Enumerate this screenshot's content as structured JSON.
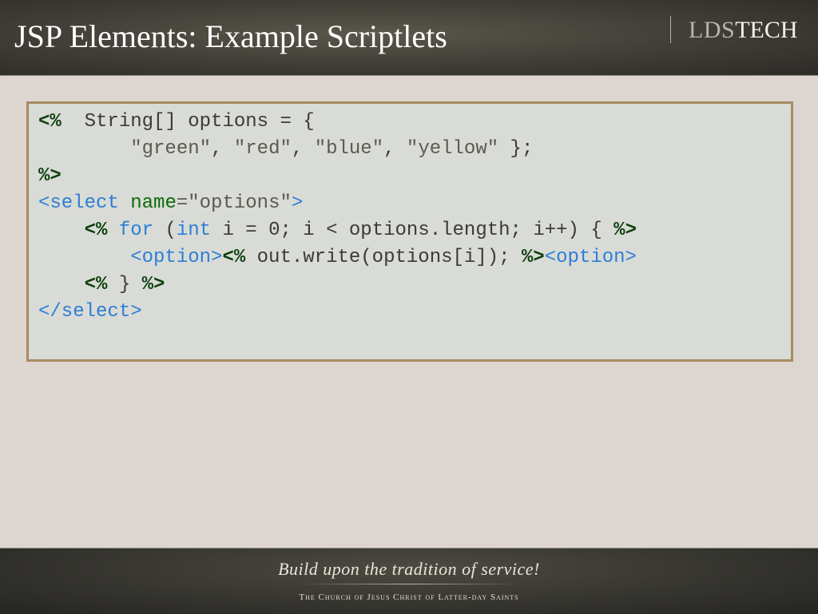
{
  "slide": {
    "title": "JSP Elements: Example Scriptlets"
  },
  "logo": {
    "part1": "LDS",
    "part2": "TECH"
  },
  "code": {
    "line1": {
      "t1": "<%",
      "t2": "  String[] options = {"
    },
    "line2": {
      "t1": "        ",
      "t2": "\"green\"",
      "t3": ", ",
      "t4": "\"red\"",
      "t5": ", ",
      "t6": "\"blue\"",
      "t7": ", ",
      "t8": "\"yellow\"",
      "t9": " };"
    },
    "line3": {
      "t1": "%>"
    },
    "line4": {
      "t1": "<select",
      "t2": " ",
      "t3": "name",
      "t4": "=",
      "t5": "\"options\"",
      "t6": ">"
    },
    "line5": {
      "t1": "    ",
      "t2": "<%",
      "t3": " ",
      "t4": "for",
      "t5": " (",
      "t6": "int",
      "t7": " i = 0; i < options.length; i++) { ",
      "t8": "%>"
    },
    "line6": {
      "t1": "        ",
      "t2": "<option>",
      "t3": "<%",
      "t4": " out.write(options[i]); ",
      "t5": "%>",
      "t6": "<option>"
    },
    "line7": {
      "t1": "    ",
      "t2": "<%",
      "t3": " } ",
      "t4": "%>"
    },
    "line8": {
      "t1": "</select>"
    }
  },
  "footer": {
    "tagline": "Build upon the tradition of service!",
    "church": "The Church of Jesus Christ of Latter-day Saints"
  },
  "colors": {
    "header_bg": "#3f3d36",
    "slide_bg": "#ddd5cf",
    "code_bg": "#d9dbd6",
    "code_border": "#a78b62",
    "scriptlet_tag": "#0c3f0c",
    "html_keyword": "#2d7ed6",
    "attribute": "#0c6b0c",
    "string": "#5d5952"
  }
}
